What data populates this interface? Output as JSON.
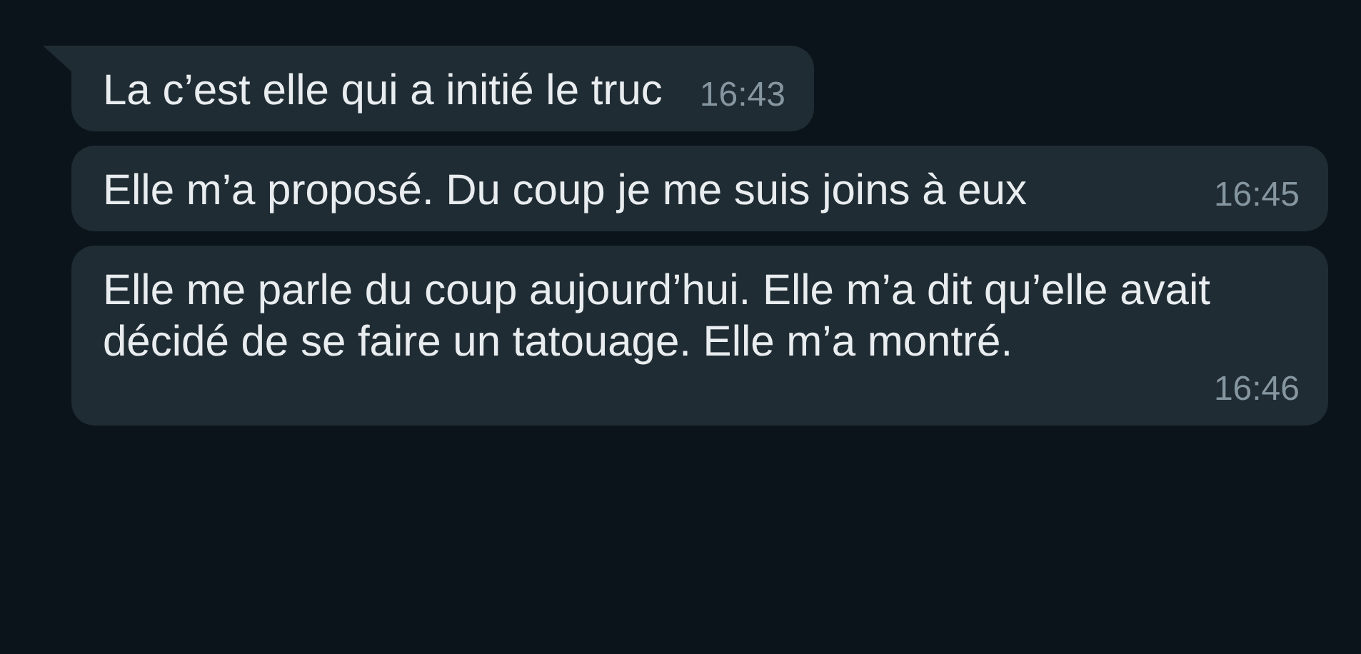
{
  "messages": [
    {
      "text": "La c’est elle qui a initié le truc",
      "time": "16:43",
      "tail": true
    },
    {
      "text": "Elle m’a proposé. Du coup je me suis joins à eux",
      "time": "16:45",
      "tail": false
    },
    {
      "text": "Elle me parle du coup aujourd’hui. Elle m’a dit qu’elle avait décidé de se faire un tatouage. Elle m’a montré.",
      "time": "16:46",
      "tail": false
    }
  ]
}
